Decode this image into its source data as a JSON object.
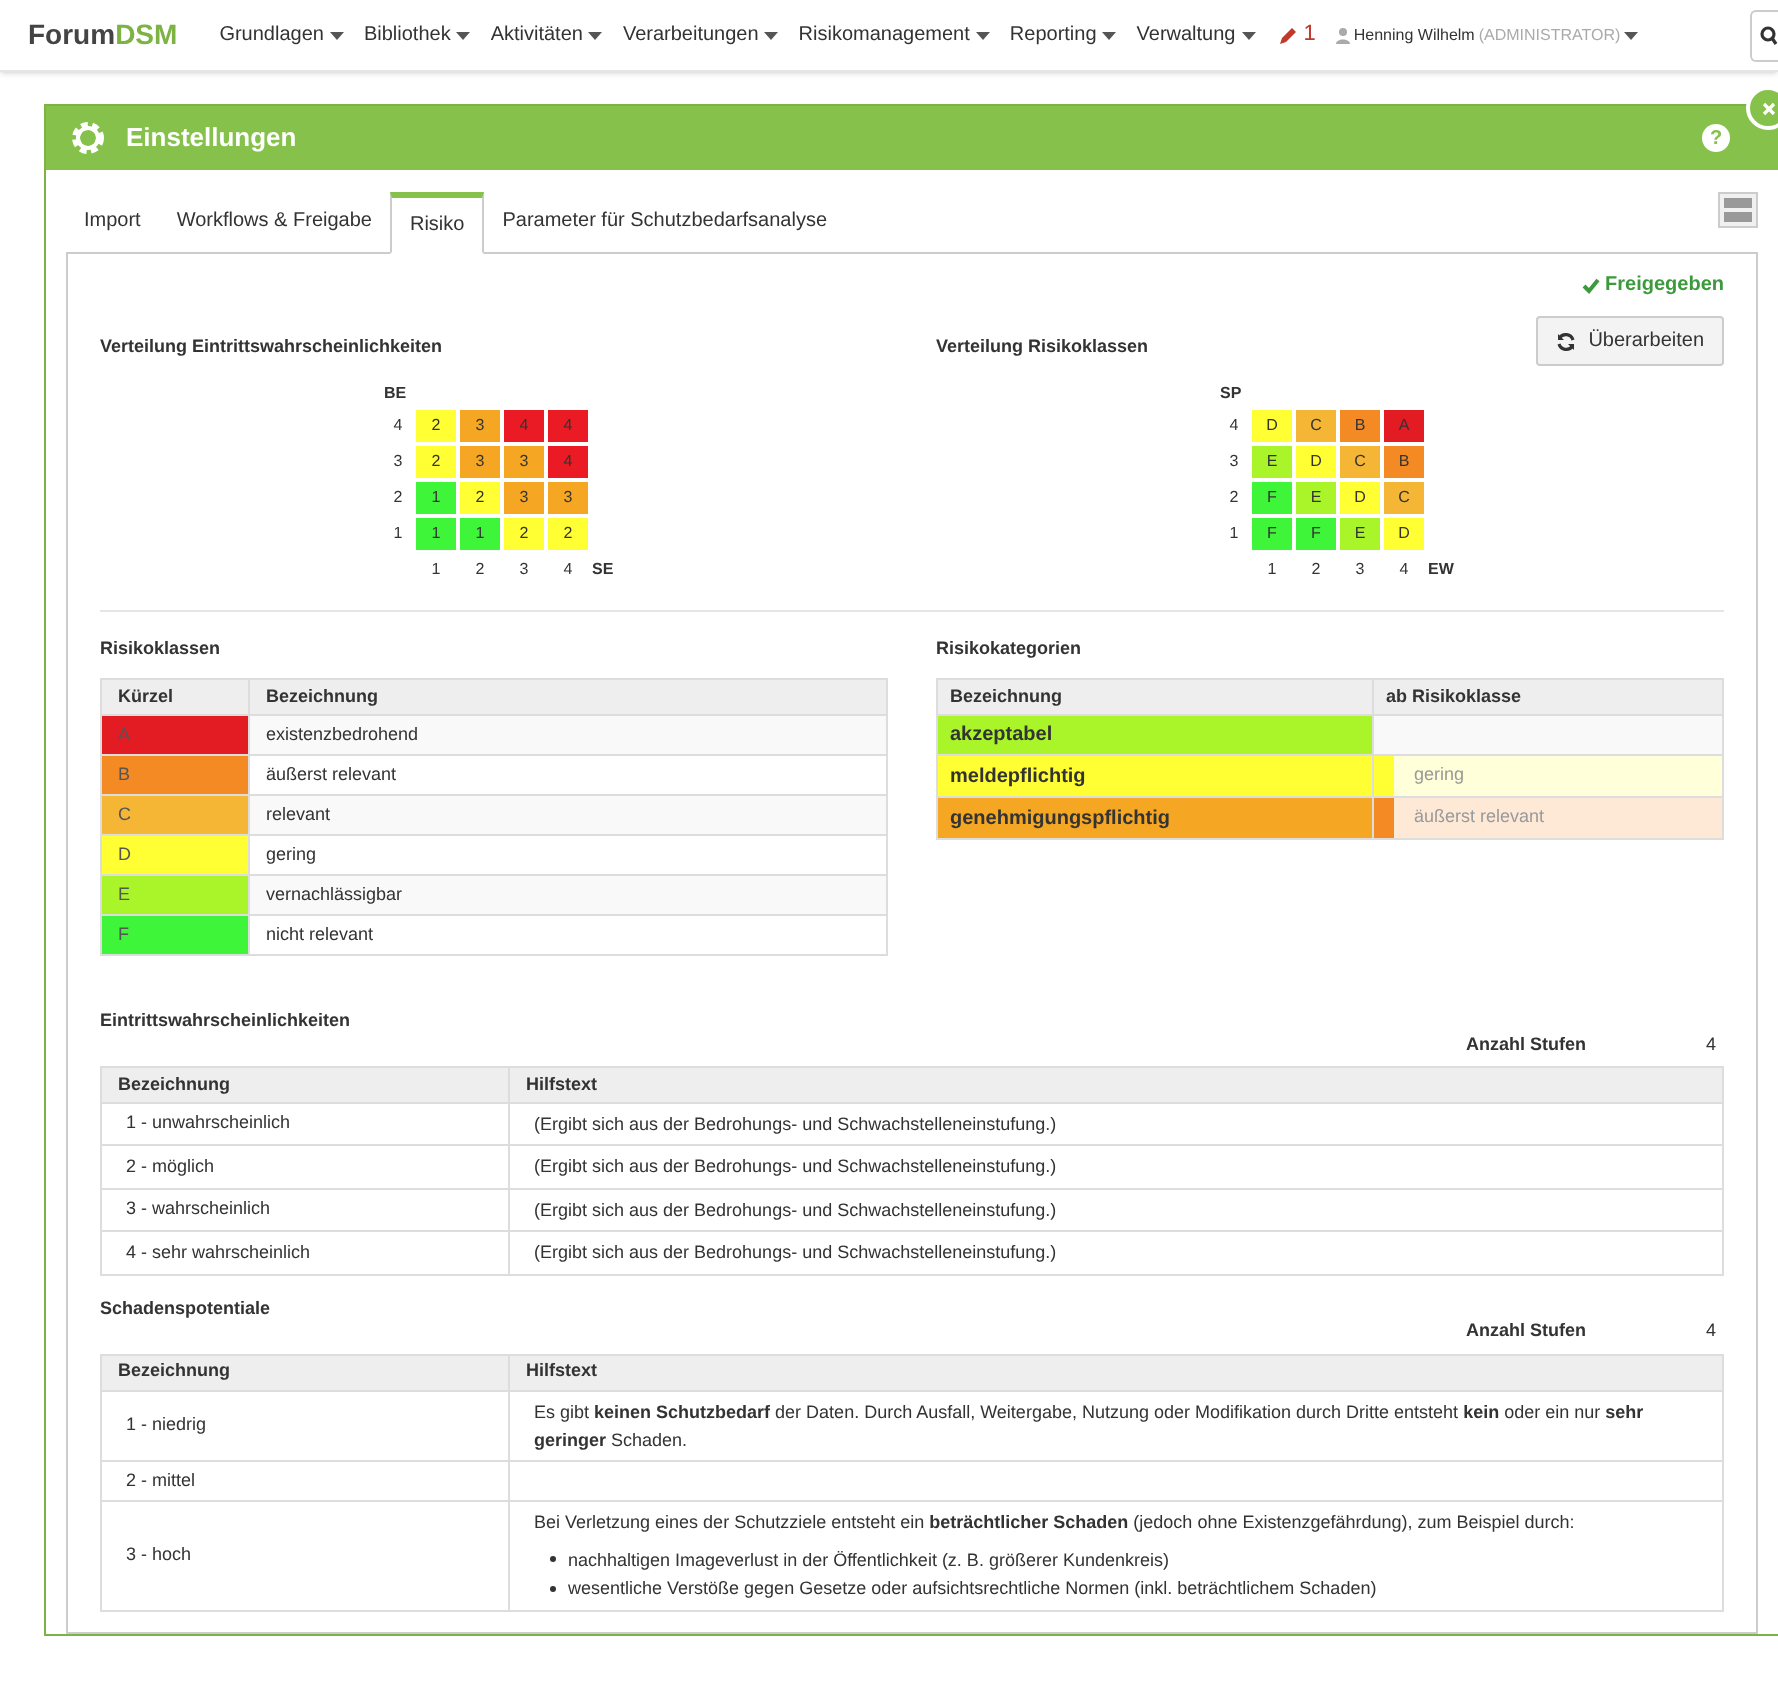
{
  "navbar": {
    "brand": {
      "prefix": "Forum",
      "suffix": "DSM"
    },
    "menu": [
      {
        "label": "Grundlagen"
      },
      {
        "label": "Bibliothek"
      },
      {
        "label": "Aktivitäten"
      },
      {
        "label": "Verarbeitungen"
      },
      {
        "label": "Risikomanagement"
      },
      {
        "label": "Reporting"
      },
      {
        "label": "Verwaltung"
      }
    ],
    "edit_count": "1",
    "user": {
      "name": "Henning Wilhelm",
      "role": "(ADMINISTRATOR)"
    }
  },
  "panel": {
    "title": "Einstellungen",
    "help": "?"
  },
  "tabs": [
    {
      "label": "Import",
      "selected": false
    },
    {
      "label": "Workflows & Freigabe",
      "selected": false
    },
    {
      "label": "Risiko",
      "selected": true
    },
    {
      "label": "Parameter für Schutzbedarfsanalyse",
      "selected": false
    }
  ],
  "status": "Freigegeben",
  "revise_button": "Überarbeiten",
  "matrices": [
    {
      "title": "Verteilung Eintrittswahrscheinlichkeiten",
      "y_axis": "BE",
      "x_axis": "SE",
      "x_labels": [
        "1",
        "2",
        "3",
        "4"
      ],
      "rows": [
        {
          "label": "4",
          "cells": [
            {
              "value": "2",
              "color": "#ffff33"
            },
            {
              "value": "3",
              "color": "#f5a623"
            },
            {
              "value": "4",
              "color": "#ea1b24"
            },
            {
              "value": "4",
              "color": "#ea1b24"
            }
          ]
        },
        {
          "label": "3",
          "cells": [
            {
              "value": "2",
              "color": "#ffff33"
            },
            {
              "value": "3",
              "color": "#f5a623"
            },
            {
              "value": "3",
              "color": "#f5a623"
            },
            {
              "value": "4",
              "color": "#ea1b24"
            }
          ]
        },
        {
          "label": "2",
          "cells": [
            {
              "value": "1",
              "color": "#3ef53a"
            },
            {
              "value": "2",
              "color": "#ffff33"
            },
            {
              "value": "3",
              "color": "#f5a623"
            },
            {
              "value": "3",
              "color": "#f5a623"
            }
          ]
        },
        {
          "label": "1",
          "cells": [
            {
              "value": "1",
              "color": "#3ef53a"
            },
            {
              "value": "1",
              "color": "#3ef53a"
            },
            {
              "value": "2",
              "color": "#ffff33"
            },
            {
              "value": "2",
              "color": "#ffff33"
            }
          ]
        }
      ]
    },
    {
      "title": "Verteilung Risikoklassen",
      "y_axis": "SP",
      "x_axis": "EW",
      "x_labels": [
        "1",
        "2",
        "3",
        "4"
      ],
      "rows": [
        {
          "label": "4",
          "cells": [
            {
              "value": "D",
              "color": "#ffff33"
            },
            {
              "value": "C",
              "color": "#f5b535"
            },
            {
              "value": "B",
              "color": "#f38a24"
            },
            {
              "value": "A",
              "color": "#e31b23"
            }
          ]
        },
        {
          "label": "3",
          "cells": [
            {
              "value": "E",
              "color": "#aaf52a"
            },
            {
              "value": "D",
              "color": "#ffff33"
            },
            {
              "value": "C",
              "color": "#f5b535"
            },
            {
              "value": "B",
              "color": "#f38a24"
            }
          ]
        },
        {
          "label": "2",
          "cells": [
            {
              "value": "F",
              "color": "#3ef53a"
            },
            {
              "value": "E",
              "color": "#aaf52a"
            },
            {
              "value": "D",
              "color": "#ffff33"
            },
            {
              "value": "C",
              "color": "#f5b535"
            }
          ]
        },
        {
          "label": "1",
          "cells": [
            {
              "value": "F",
              "color": "#3ef53a"
            },
            {
              "value": "F",
              "color": "#3ef53a"
            },
            {
              "value": "E",
              "color": "#aaf52a"
            },
            {
              "value": "D",
              "color": "#ffff33"
            }
          ]
        }
      ]
    }
  ],
  "risk_classes": {
    "title": "Risikoklassen",
    "columns": [
      "Kürzel",
      "Bezeichnung"
    ],
    "rows": [
      {
        "code": "A",
        "name": "existenzbedrohend",
        "color": "#e31b23"
      },
      {
        "code": "B",
        "name": "äußerst relevant",
        "color": "#f38a24"
      },
      {
        "code": "C",
        "name": "relevant",
        "color": "#f5b535"
      },
      {
        "code": "D",
        "name": "gering",
        "color": "#ffff33"
      },
      {
        "code": "E",
        "name": "vernachlässigbar",
        "color": "#aaf52a"
      },
      {
        "code": "F",
        "name": "nicht relevant",
        "color": "#3ef53a"
      }
    ]
  },
  "risk_categories": {
    "title": "Risikokategorien",
    "columns": [
      "Bezeichnung",
      "ab Risikoklasse"
    ],
    "rows": [
      {
        "name": "akzeptabel",
        "color": "#aaf52a"
      },
      {
        "name": "meldepflichtig",
        "color": "#ffff33",
        "threshold": {
          "label": "gering",
          "color": "#ffff33"
        }
      },
      {
        "name": "genehmigungspflichtig",
        "color": "#f5a623",
        "threshold": {
          "label": "äußerst relevant",
          "color": "#f38a24"
        }
      }
    ]
  },
  "levels": [
    {
      "title": "Eintrittswahrscheinlichkeiten",
      "count_label": "Anzahl Stufen",
      "count": "4",
      "columns": [
        "Bezeichnung",
        "Hilfstext"
      ],
      "rows": [
        {
          "name": "1 - unwahrscheinlich",
          "help": "(Ergibt sich aus der Bedrohungs- und Schwachstelleneinstufung.)"
        },
        {
          "name": "2 - möglich",
          "help": "(Ergibt sich aus der Bedrohungs- und Schwachstelleneinstufung.)"
        },
        {
          "name": "3 - wahrscheinlich",
          "help": "(Ergibt sich aus der Bedrohungs- und Schwachstelleneinstufung.)"
        },
        {
          "name": "4 - sehr wahrscheinlich",
          "help": "(Ergibt sich aus der Bedrohungs- und Schwachstelleneinstufung.)"
        }
      ]
    },
    {
      "title": "Schadenspotentiale",
      "count_label": "Anzahl Stufen",
      "count": "4",
      "columns": [
        "Bezeichnung",
        "Hilfstext"
      ],
      "rows": [
        {
          "name": "1 - niedrig",
          "help": "Es gibt **keinen Schutzbedarf** der Daten. Durch Ausfall, Weitergabe, Nutzung oder Modifikation durch Dritte entsteht **kein** oder ein nur **sehr geringer** Schaden."
        },
        {
          "name": "2 - mittel"
        },
        {
          "name": "3 - hoch",
          "help": "Bei Verletzung eines der Schutzziele entsteht ein **beträchtlicher Schaden** (jedoch ohne Existenzgefährdung), zum Beispiel durch:",
          "bullets": [
            "nachhaltigen Imageverlust in der Öffentlichkeit (z. B. größerer Kundenkreis)",
            "wesentliche Verstöße gegen Gesetze oder aufsichtsrechtliche Normen (inkl. beträchtlichem Schaden)"
          ]
        }
      ]
    }
  ]
}
